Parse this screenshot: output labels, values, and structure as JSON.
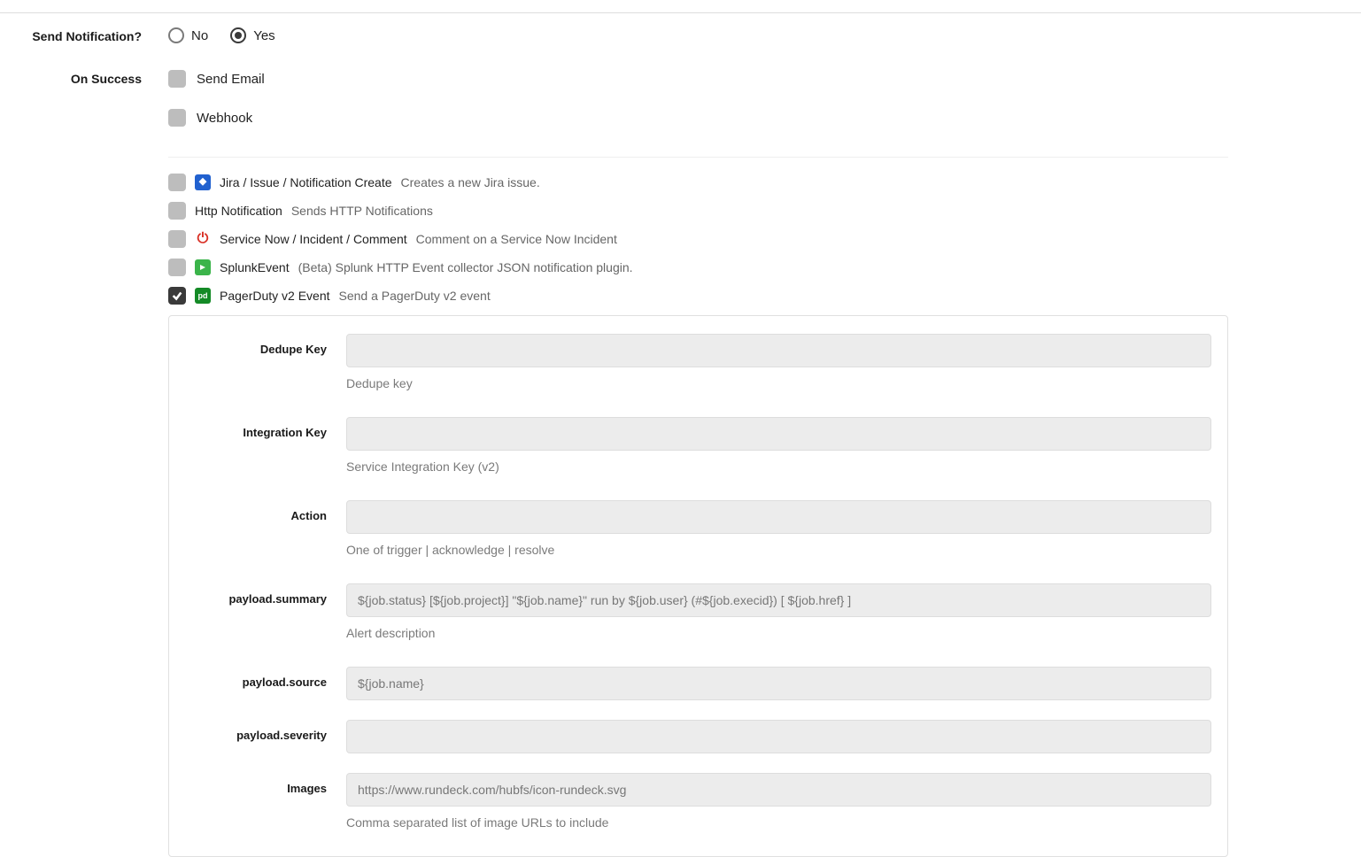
{
  "sendNotification": {
    "label": "Send Notification?",
    "no": "No",
    "yes": "Yes"
  },
  "onSuccess": {
    "label": "On Success",
    "sendEmail": "Send Email",
    "webhook": "Webhook"
  },
  "plugins": {
    "jira": {
      "name": "Jira / Issue / Notification Create",
      "desc": "Creates a new Jira issue."
    },
    "http": {
      "name": "Http Notification",
      "desc": "Sends HTTP Notifications"
    },
    "snow": {
      "name": "Service Now / Incident / Comment",
      "desc": "Comment on a Service Now Incident"
    },
    "splunk": {
      "name": "SplunkEvent",
      "desc": "(Beta) Splunk HTTP Event collector JSON notification plugin."
    },
    "pd": {
      "name": "PagerDuty v2 Event",
      "desc": "Send a PagerDuty v2 event"
    }
  },
  "config": {
    "dedupe": {
      "label": "Dedupe Key",
      "help": "Dedupe key"
    },
    "integration": {
      "label": "Integration Key",
      "help": "Service Integration Key (v2)"
    },
    "action": {
      "label": "Action",
      "help": "One of trigger | acknowledge | resolve"
    },
    "summary": {
      "label": "payload.summary",
      "placeholder": "${job.status} [${job.project}] \"${job.name}\" run by ${job.user} (#${job.execid}) [ ${job.href} ]",
      "help": "Alert description"
    },
    "source": {
      "label": "payload.source",
      "placeholder": "${job.name}"
    },
    "severity": {
      "label": "payload.severity"
    },
    "images": {
      "label": "Images",
      "placeholder": "https://www.rundeck.com/hubfs/icon-rundeck.svg",
      "help": "Comma separated list of image URLs to include"
    }
  }
}
